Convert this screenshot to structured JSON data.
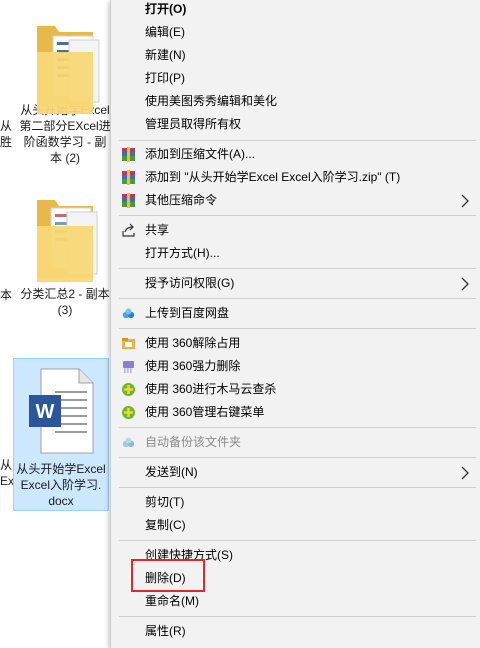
{
  "desktop": {
    "files": [
      {
        "name_lines": [
          "从头开始学Excel",
          "第二部分EXcel进",
          "阶函数学习 - 副",
          "本 (2)"
        ]
      },
      {
        "name_lines": [
          "分类汇总2 - 副本",
          "(3)"
        ]
      },
      {
        "name_lines": [
          "从头开始学Excel",
          "Excel入阶学习.",
          "docx"
        ]
      }
    ],
    "left_cut": [
      "从",
      "胜",
      "本",
      "从",
      "Ex"
    ]
  },
  "context_menu": {
    "items": [
      {
        "label": "打开(O)",
        "bold": true
      },
      {
        "label": "编辑(E)"
      },
      {
        "label": "新建(N)"
      },
      {
        "label": "打印(P)"
      },
      {
        "label": "使用美图秀秀编辑和美化"
      },
      {
        "label": "管理员取得所有权"
      },
      {
        "label": "添加到压缩文件(A)...",
        "icon": "winrar-icon"
      },
      {
        "label": "添加到 \"从头开始学Excel Excel入阶学习.zip\" (T)",
        "icon": "winrar-icon"
      },
      {
        "label": "其他压缩命令",
        "icon": "winrar-icon",
        "submenu": true
      },
      {
        "label": "共享",
        "icon": "share-icon"
      },
      {
        "label": "打开方式(H)..."
      },
      {
        "label": "授予访问权限(G)",
        "submenu": true
      },
      {
        "label": "上传到百度网盘",
        "icon": "baidu-cloud-icon"
      },
      {
        "label": "使用 360解除占用",
        "icon": "360-unlock-icon"
      },
      {
        "label": "使用 360强力删除",
        "icon": "360-shred-icon"
      },
      {
        "label": "使用 360进行木马云查杀",
        "icon": "360-scan-icon"
      },
      {
        "label": "使用 360管理右键菜单",
        "icon": "360-scan-icon"
      },
      {
        "label": "自动备份该文件夹",
        "icon": "baidu-cloud-icon",
        "disabled": true
      },
      {
        "label": "发送到(N)",
        "submenu": true
      },
      {
        "label": "剪切(T)"
      },
      {
        "label": "复制(C)"
      },
      {
        "label": "创建快捷方式(S)"
      },
      {
        "label": "删除(D)"
      },
      {
        "label": "重命名(M)"
      },
      {
        "label": "属性(R)"
      }
    ]
  },
  "colors": {
    "menu_bg": "#f2f2f2",
    "selection_bg": "#cce8ff",
    "highlight_border": "#e02a2a",
    "word_blue": "#2b579a",
    "folder_yellow": "#f8d775"
  }
}
